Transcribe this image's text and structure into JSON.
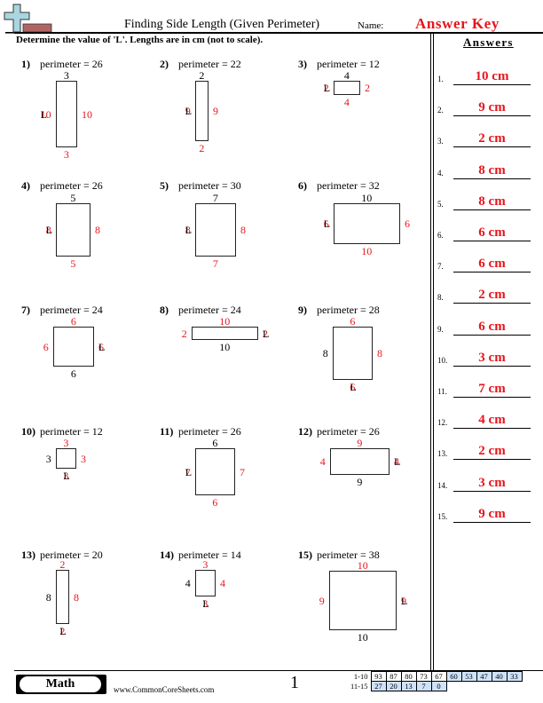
{
  "header": {
    "title": "Finding Side Length (Given Perimeter)",
    "name_label": "Name:",
    "name_value": "Answer Key",
    "logo_icon": "plus-ruler-logo-icon"
  },
  "instructions": "Determine the value of 'L'. Lengths are in cm (not to scale).",
  "answers": {
    "heading": "Answers",
    "items": [
      {
        "num": "1.",
        "value": "10 cm"
      },
      {
        "num": "2.",
        "value": "9 cm"
      },
      {
        "num": "3.",
        "value": "2 cm"
      },
      {
        "num": "4.",
        "value": "8 cm"
      },
      {
        "num": "5.",
        "value": "8 cm"
      },
      {
        "num": "6.",
        "value": "6 cm"
      },
      {
        "num": "7.",
        "value": "6 cm"
      },
      {
        "num": "8.",
        "value": "2 cm"
      },
      {
        "num": "9.",
        "value": "6 cm"
      },
      {
        "num": "10.",
        "value": "3 cm"
      },
      {
        "num": "11.",
        "value": "7 cm"
      },
      {
        "num": "12.",
        "value": "4 cm"
      },
      {
        "num": "13.",
        "value": "2 cm"
      },
      {
        "num": "14.",
        "value": "3 cm"
      },
      {
        "num": "15.",
        "value": "9 cm"
      }
    ]
  },
  "problems": [
    {
      "num": "1)",
      "text": "perimeter = 26",
      "top": {
        "t": "3",
        "c": "black"
      },
      "bottom": {
        "t": "3",
        "c": "red"
      },
      "left": {
        "t": "10",
        "c": "L"
      },
      "right": {
        "t": "10",
        "c": "red"
      }
    },
    {
      "num": "2)",
      "text": "perimeter = 22",
      "top": {
        "t": "2",
        "c": "black"
      },
      "bottom": {
        "t": "2",
        "c": "red"
      },
      "left": {
        "t": "9",
        "c": "L"
      },
      "right": {
        "t": "9",
        "c": "red"
      }
    },
    {
      "num": "3)",
      "text": "perimeter = 12",
      "top": {
        "t": "4",
        "c": "black"
      },
      "bottom": {
        "t": "4",
        "c": "red"
      },
      "left": {
        "t": "2",
        "c": "L"
      },
      "right": {
        "t": "2",
        "c": "red"
      }
    },
    {
      "num": "4)",
      "text": "perimeter = 26",
      "top": {
        "t": "5",
        "c": "black"
      },
      "bottom": {
        "t": "5",
        "c": "red"
      },
      "left": {
        "t": "8",
        "c": "L"
      },
      "right": {
        "t": "8",
        "c": "red"
      }
    },
    {
      "num": "5)",
      "text": "perimeter = 30",
      "top": {
        "t": "7",
        "c": "black"
      },
      "bottom": {
        "t": "7",
        "c": "red"
      },
      "left": {
        "t": "8",
        "c": "L"
      },
      "right": {
        "t": "8",
        "c": "red"
      }
    },
    {
      "num": "6)",
      "text": "perimeter = 32",
      "top": {
        "t": "10",
        "c": "black"
      },
      "bottom": {
        "t": "10",
        "c": "red"
      },
      "left": {
        "t": "6",
        "c": "L"
      },
      "right": {
        "t": "6",
        "c": "red"
      }
    },
    {
      "num": "7)",
      "text": "perimeter = 24",
      "top": {
        "t": "6",
        "c": "red"
      },
      "bottom": {
        "t": "6",
        "c": "black"
      },
      "left": {
        "t": "6",
        "c": "red"
      },
      "right": {
        "t": "6",
        "c": "L"
      }
    },
    {
      "num": "8)",
      "text": "perimeter = 24",
      "top": {
        "t": "10",
        "c": "red"
      },
      "bottom": {
        "t": "10",
        "c": "black"
      },
      "left": {
        "t": "2",
        "c": "red"
      },
      "right": {
        "t": "2",
        "c": "L"
      }
    },
    {
      "num": "9)",
      "text": "perimeter = 28",
      "top": {
        "t": "6",
        "c": "red"
      },
      "bottom": {
        "t": "6",
        "c": "L"
      },
      "left": {
        "t": "8",
        "c": "black"
      },
      "right": {
        "t": "8",
        "c": "red"
      }
    },
    {
      "num": "10)",
      "text": "perimeter = 12",
      "top": {
        "t": "3",
        "c": "red"
      },
      "bottom": {
        "t": "3",
        "c": "L"
      },
      "left": {
        "t": "3",
        "c": "black"
      },
      "right": {
        "t": "3",
        "c": "red"
      }
    },
    {
      "num": "11)",
      "text": "perimeter = 26",
      "top": {
        "t": "6",
        "c": "black"
      },
      "bottom": {
        "t": "6",
        "c": "red"
      },
      "left": {
        "t": "7",
        "c": "L"
      },
      "right": {
        "t": "7",
        "c": "red"
      }
    },
    {
      "num": "12)",
      "text": "perimeter = 26",
      "top": {
        "t": "9",
        "c": "red"
      },
      "bottom": {
        "t": "9",
        "c": "black"
      },
      "left": {
        "t": "4",
        "c": "red"
      },
      "right": {
        "t": "4",
        "c": "L"
      }
    },
    {
      "num": "13)",
      "text": "perimeter = 20",
      "top": {
        "t": "2",
        "c": "red"
      },
      "bottom": {
        "t": "2",
        "c": "L"
      },
      "left": {
        "t": "8",
        "c": "black"
      },
      "right": {
        "t": "8",
        "c": "red"
      }
    },
    {
      "num": "14)",
      "text": "perimeter = 14",
      "top": {
        "t": "3",
        "c": "red"
      },
      "bottom": {
        "t": "3",
        "c": "L"
      },
      "left": {
        "t": "4",
        "c": "black"
      },
      "right": {
        "t": "4",
        "c": "red"
      }
    },
    {
      "num": "15)",
      "text": "perimeter = 38",
      "top": {
        "t": "10",
        "c": "red"
      },
      "bottom": {
        "t": "10",
        "c": "black"
      },
      "left": {
        "t": "9",
        "c": "red"
      },
      "right": {
        "t": "9",
        "c": "L"
      }
    }
  ],
  "unknown_label": "L",
  "colors": {
    "answer_red": "#e8141c",
    "score_highlight": "#cfe2fa",
    "logo_cross": "#a9d6e0",
    "logo_ruler": "#b06464"
  },
  "footer": {
    "subject": "Math",
    "website": "www.CommonCoreSheets.com",
    "page_number": "1",
    "score_table": {
      "rows": [
        {
          "label": "1-10",
          "cells": [
            "93",
            "87",
            "80",
            "73",
            "67",
            "60",
            "53",
            "47",
            "40",
            "33"
          ],
          "highlight_from": 5
        },
        {
          "label": "11-15",
          "cells": [
            "27",
            "20",
            "13",
            "7",
            "0"
          ],
          "highlight_from": 0
        }
      ]
    }
  }
}
